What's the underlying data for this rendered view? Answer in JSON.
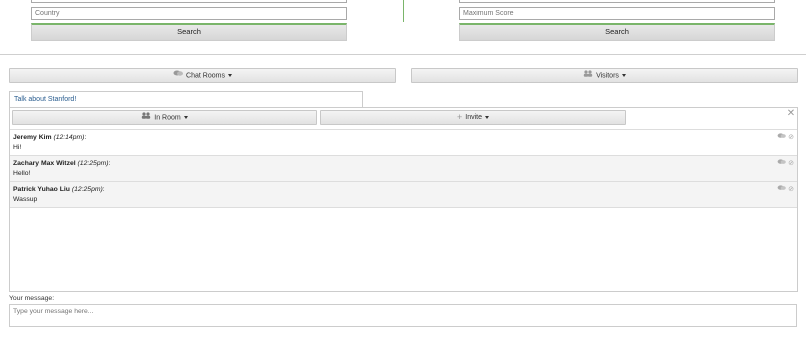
{
  "search_left": {
    "country_placeholder": "Country",
    "search_label": "Search"
  },
  "search_right": {
    "max_score_placeholder": "Maximum Score",
    "search_label": "Search"
  },
  "toolbar": {
    "chat_rooms_label": "Chat Rooms",
    "visitors_label": "Visitors"
  },
  "room": {
    "tab_label": "Talk about Stanford!",
    "in_room_label": "In Room",
    "invite_label": "Invite",
    "close_symbol": "✕"
  },
  "messages": [
    {
      "author": "Jeremy Kim",
      "time": "(12:14pm)",
      "text": "Hi!"
    },
    {
      "author": "Zachary Max Witzel",
      "time": "(12:25pm)",
      "text": "Hello!"
    },
    {
      "author": "Patrick Yuhao Liu",
      "time": "(12:25pm)",
      "text": "Wassup"
    }
  ],
  "composer": {
    "label": "Your message:",
    "placeholder": "Type your message here..."
  },
  "colors": {
    "accent_green": "#7ab56a",
    "link_blue": "#2a5d8f"
  }
}
